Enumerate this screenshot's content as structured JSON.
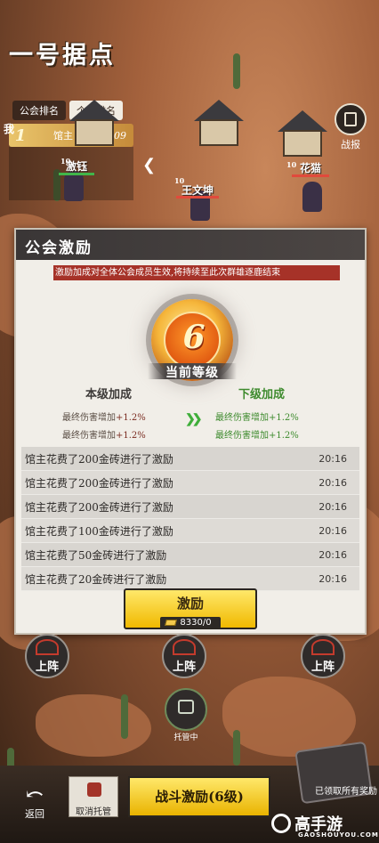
{
  "map": {
    "title": "一号据点"
  },
  "ranking": {
    "tabs": [
      "公会排名",
      "个人排名"
    ],
    "me_label": "我",
    "row": {
      "rank": "1",
      "name": "馆主",
      "score": "1009"
    }
  },
  "report": {
    "label": "战报"
  },
  "units": [
    {
      "name": "激钰",
      "level": "10"
    },
    {
      "name": "王文坤",
      "level": "10"
    },
    {
      "name": "花猫",
      "level": "10"
    }
  ],
  "dialog": {
    "title": "公会激励",
    "notice": "激励加成对全体公会成员生效,将持续至此次群雄逐鹿结束",
    "level": "6",
    "level_label": "当前等级",
    "current_header": "本级加成",
    "next_header": "下级加成",
    "current_bonus": [
      {
        "text": "最终伤害增加",
        "value": "+1.2%"
      },
      {
        "text": "最终伤害增加",
        "value": "+1.2%"
      }
    ],
    "next_bonus": [
      {
        "text": "最终伤害增加",
        "value": "+1.2%"
      },
      {
        "text": "最终伤害增加",
        "value": "+1.2%"
      }
    ],
    "log": [
      {
        "text": "馆主花费了200金砖进行了激励",
        "time": "20:16"
      },
      {
        "text": "馆主花费了200金砖进行了激励",
        "time": "20:16"
      },
      {
        "text": "馆主花费了200金砖进行了激励",
        "time": "20:16"
      },
      {
        "text": "馆主花费了100金砖进行了激励",
        "time": "20:16"
      },
      {
        "text": "馆主花费了50金砖进行了激励",
        "time": "20:16"
      },
      {
        "text": "馆主花费了20金砖进行了激励",
        "time": "20:16"
      }
    ],
    "inspire_button": {
      "label": "激励",
      "cost": "8330/0"
    }
  },
  "scene": {
    "deploy_label": "上阵",
    "robot_label": "托管中"
  },
  "bottom": {
    "back": "返回",
    "cancel": "取消托管",
    "battle": "战斗激励(6级)",
    "chest_label": "已领取所有奖励"
  },
  "watermark": {
    "brand": "高手游",
    "url": "GAOSHOUYOU.COM"
  },
  "colors": {
    "accent_gold": "#f0b900",
    "notice_red": "#a63228",
    "next_green": "#3e8b2e"
  }
}
